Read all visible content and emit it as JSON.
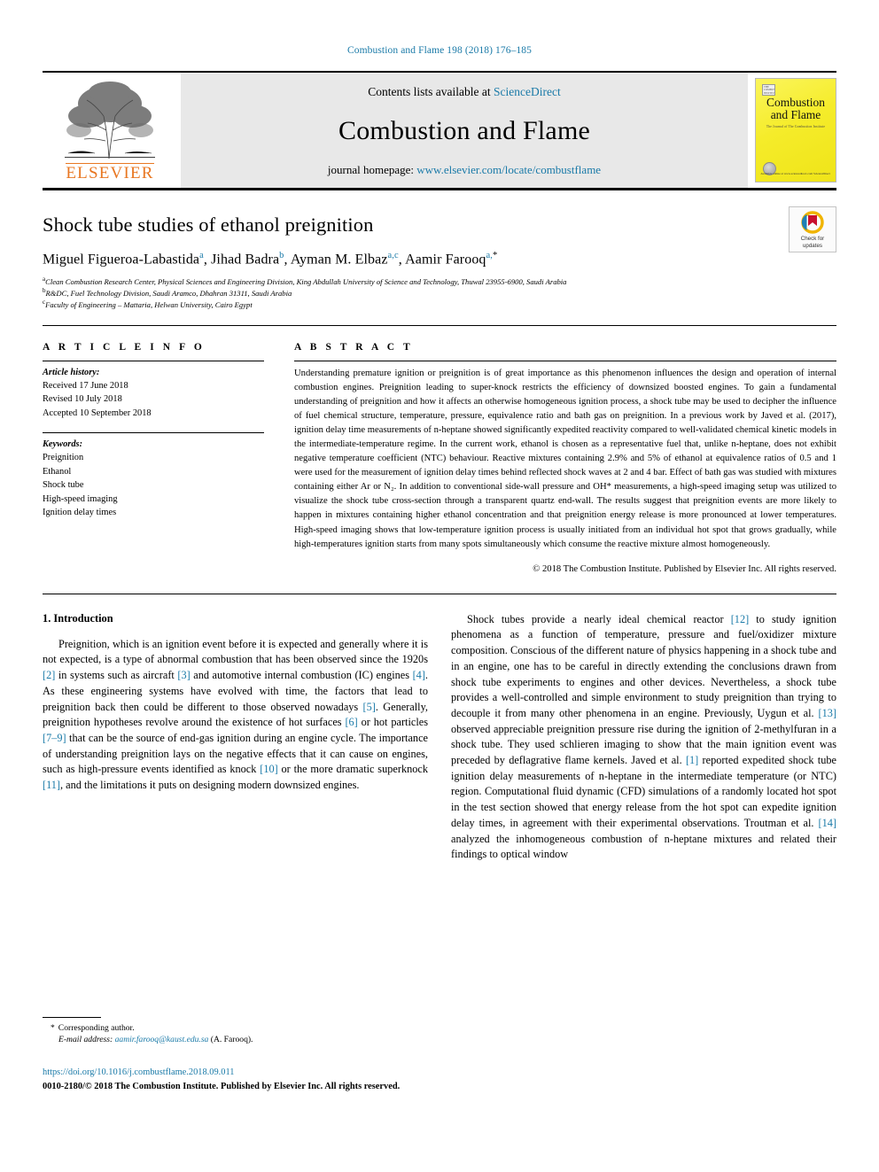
{
  "running_head": "Combustion and Flame 198 (2018) 176–185",
  "masthead": {
    "contents_prefix": "Contents lists available at",
    "sciencedirect": "ScienceDirect",
    "journal_name": "Combustion and Flame",
    "homepage_prefix": "journal homepage:",
    "homepage_url": "www.elsevier.com/locate/combustflame",
    "publisher": "ELSEVIER",
    "publisher_logo_icon": "elsevier-tree-icon",
    "cover": {
      "title_line1": "Combustion",
      "title_line2": "and Flame",
      "subtitle": "The Journal of The Combustion Institute",
      "badge_text": "THE COMBUSTION INSTITUTE",
      "footer_text": "Available online at www.sciencedirect.com\nScienceDirect"
    }
  },
  "article": {
    "title": "Shock tube studies of ethanol preignition",
    "authors": [
      {
        "name": "Miguel Figueroa-Labastida",
        "marks": "a",
        "sep": ", "
      },
      {
        "name": "Jihad Badra",
        "marks": "b",
        "sep": ", "
      },
      {
        "name": "Ayman M. Elbaz",
        "marks": "a,c",
        "sep": ", "
      },
      {
        "name": "Aamir Farooq",
        "marks": "a,",
        "star": "*",
        "sep": ""
      }
    ],
    "affiliations": [
      {
        "mark": "a",
        "text": "Clean Combustion Research Center, Physical Sciences and Engineering Division, King Abdullah University of Science and Technology, Thuwal 23955-6900, Saudi Arabia"
      },
      {
        "mark": "b",
        "text": "R&DC, Fuel Technology Division, Saudi Aramco, Dhahran 31311, Saudi Arabia"
      },
      {
        "mark": "c",
        "text": "Faculty of Engineering – Mattaria, Helwan University, Cairo Egypt"
      }
    ],
    "crossmark": {
      "icon": "crossmark-check-for-updates-icon",
      "label_line1": "Check for",
      "label_line2": "updates"
    }
  },
  "article_info": {
    "heading": "A R T I C L E   I N F O",
    "history_label": "Article history:",
    "history": [
      "Received 17 June 2018",
      "Revised 10 July 2018",
      "Accepted 10 September 2018"
    ],
    "keywords_label": "Keywords:",
    "keywords": [
      "Preignition",
      "Ethanol",
      "Shock tube",
      "High-speed imaging",
      "Ignition delay times"
    ]
  },
  "abstract": {
    "heading": "A B S T R A C T",
    "text": "Understanding premature ignition or preignition is of great importance as this phenomenon influences the design and operation of internal combustion engines. Preignition leading to super-knock restricts the efficiency of downsized boosted engines. To gain a fundamental understanding of preignition and how it affects an otherwise homogeneous ignition process, a shock tube may be used to decipher the influence of fuel chemical structure, temperature, pressure, equivalence ratio and bath gas on preignition. In a previous work by Javed et al. (2017), ignition delay time measurements of n-heptane showed significantly expedited reactivity compared to well-validated chemical kinetic models in the intermediate-temperature regime. In the current work, ethanol is chosen as a representative fuel that, unlike n-heptane, does not exhibit negative temperature coefficient (NTC) behaviour. Reactive mixtures containing 2.9% and 5% of ethanol at equivalence ratios of 0.5 and 1 were used for the measurement of ignition delay times behind reflected shock waves at 2 and 4 bar. Effect of bath gas was studied with mixtures containing either Ar or N₂. In addition to conventional side-wall pressure and OH* measurements, a high-speed imaging setup was utilized to visualize the shock tube cross-section through a transparent quartz end-wall. The results suggest that preignition events are more likely to happen in mixtures containing higher ethanol concentration and that preignition energy release is more pronounced at lower temperatures. High-speed imaging shows that low-temperature ignition process is usually initiated from an individual hot spot that grows gradually, while high-temperatures ignition starts from many spots simultaneously which consume the reactive mixture almost homogeneously.",
    "copyright": "© 2018 The Combustion Institute. Published by Elsevier Inc. All rights reserved."
  },
  "body": {
    "section_heading": "1. Introduction",
    "left_paragraph_1": "Preignition, which is an ignition event before it is expected and generally where it is not expected, is a type of abnormal combustion that has been observed since the 1920s [2] in systems such as aircraft [3] and automotive internal combustion (IC) engines [4]. As these engineering systems have evolved with time, the factors that lead to preignition back then could be different to those observed nowadays [5]. Generally, preignition hypotheses revolve around the existence of hot surfaces [6] or hot particles [7–9] that can be the source of end-gas ignition during an engine cycle. The importance of understanding preignition lays on the negative effects that it can cause on engines, such as high-pressure events identified as knock [10] or the more dramatic superknock [11], and the limitations it puts on designing modern downsized engines.",
    "right_paragraph_1": "Shock tubes provide a nearly ideal chemical reactor [12] to study ignition phenomena as a function of temperature, pressure and fuel/oxidizer mixture composition. Conscious of the different nature of physics happening in a shock tube and in an engine, one has to be careful in directly extending the conclusions drawn from shock tube experiments to engines and other devices. Nevertheless, a shock tube provides a well-controlled and simple environment to study preignition than trying to decouple it from many other phenomena in an engine. Previously, Uygun et al. [13] observed appreciable preignition pressure rise during the ignition of 2-methylfuran in a shock tube. They used schlieren imaging to show that the main ignition event was preceded by deflagrative flame kernels. Javed et al. [1] reported expedited shock tube ignition delay measurements of n-heptane in the intermediate temperature (or NTC) region. Computational fluid dynamic (CFD) simulations of a randomly located hot spot in the test section showed that energy release from the hot spot can expedite ignition delay times, in agreement with their experimental observations. Troutman et al. [14] analyzed the inhomogeneous combustion of n-heptane mixtures and related their findings to optical window",
    "refs_left": [
      "[2]",
      "[3]",
      "[4]",
      "[5]",
      "[6]",
      "[7–9]",
      "[10]",
      "[11]"
    ],
    "refs_right": [
      "[12]",
      "[13]",
      "[1]",
      "[14]"
    ]
  },
  "footer": {
    "star": "*",
    "corresponding_author": "Corresponding author.",
    "email_label": "E-mail address:",
    "email": "aamir.farooq@kaust.edu.sa",
    "email_suffix": "(A. Farooq).",
    "doi": "https://doi.org/10.1016/j.combustflame.2018.09.011",
    "issn_line": "0010-2180/© 2018 The Combustion Institute. Published by Elsevier Inc. All rights reserved."
  },
  "colors": {
    "link": "#1a7aa8",
    "elsevier_orange": "#E87722",
    "cover_yellow": "#f6ef38",
    "masthead_grey": "#e8e8e8"
  }
}
